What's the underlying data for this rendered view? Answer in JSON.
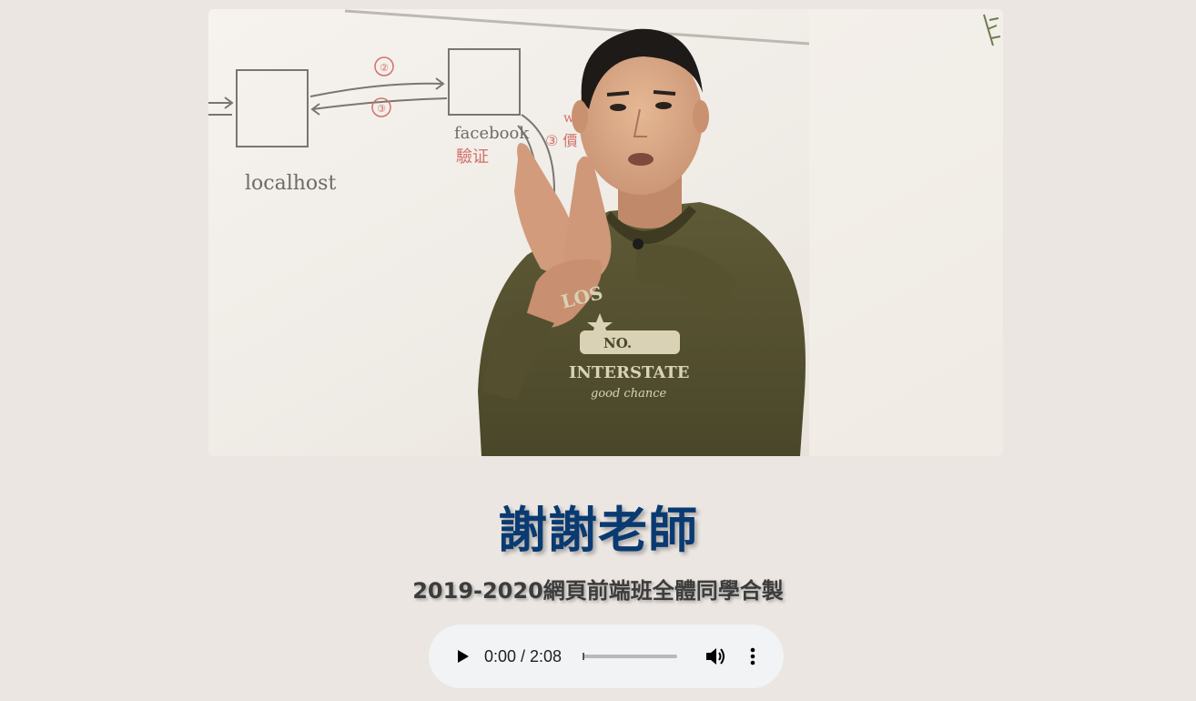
{
  "heading": {
    "title": "謝謝老師",
    "subtitle": "2019-2020網頁前端班全體同學合製"
  },
  "video": {
    "whiteboard_labels": {
      "left_box": "localhost",
      "right_box": "facebook",
      "right_box_note": "驗证",
      "arrow_step_1": "②",
      "arrow_step_2": "③",
      "side_note": "③ 價"
    },
    "sweatshirt_text": {
      "line1": "LOS",
      "line2": "NO.",
      "line3": "INTERSTATE",
      "line4": "good chance"
    }
  },
  "audio_player": {
    "time_display": "0:00 / 2:08",
    "progress": 0,
    "icons": {
      "play": "play-icon",
      "volume": "volume-icon",
      "more": "more-vertical-icon"
    }
  },
  "colors": {
    "background": "#ebe6e1",
    "title": "#0a3a72",
    "subtitle": "#3c3c3c",
    "player_bg": "#f1f3f4"
  }
}
